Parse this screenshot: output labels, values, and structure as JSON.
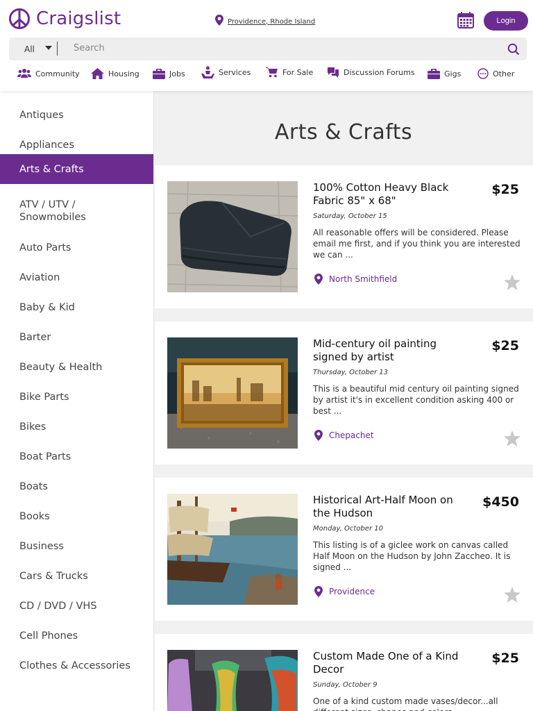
{
  "header": {
    "logo_text": "Craigslist",
    "location": "Providence, Rhode Island",
    "login_label": "Login",
    "brand_color": "#6b2c8f"
  },
  "search": {
    "category": "All",
    "placeholder": "Search"
  },
  "nav": [
    {
      "label": "Community",
      "icon": "community-icon"
    },
    {
      "label": "Housing",
      "icon": "house-icon"
    },
    {
      "label": "Jobs",
      "icon": "briefcase-icon"
    },
    {
      "label": "Services",
      "icon": "services-icon"
    },
    {
      "label": "For Sale",
      "icon": "cart-icon"
    },
    {
      "label": "Discussion Forums",
      "icon": "chat-icon"
    },
    {
      "label": "Gigs",
      "icon": "briefcase-icon"
    },
    {
      "label": "Other",
      "icon": "more-icon"
    }
  ],
  "sidebar": {
    "items": [
      {
        "label": "Antiques"
      },
      {
        "label": "Appliances"
      },
      {
        "label": "Arts & Crafts",
        "active": true
      },
      {
        "label": "ATV / UTV / Snowmobiles"
      },
      {
        "label": "Auto Parts"
      },
      {
        "label": "Aviation"
      },
      {
        "label": "Baby & Kid"
      },
      {
        "label": "Barter"
      },
      {
        "label": "Beauty & Health"
      },
      {
        "label": "Bike Parts"
      },
      {
        "label": "Bikes"
      },
      {
        "label": "Boat Parts"
      },
      {
        "label": "Boats"
      },
      {
        "label": "Books"
      },
      {
        "label": "Business"
      },
      {
        "label": "Cars & Trucks"
      },
      {
        "label": "CD / DVD / VHS"
      },
      {
        "label": "Cell Phones"
      },
      {
        "label": "Clothes & Accessories"
      }
    ]
  },
  "main": {
    "title": "Arts & Crafts",
    "listings": [
      {
        "title": "100% Cotton Heavy Black Fabric 85\" x 68\"",
        "price": "$25",
        "date": "Saturday, October 15",
        "description": "All reasonable offers will be considered. Please email me first, and if you think you are interested we can ...",
        "location": "North Smithfield"
      },
      {
        "title": "Mid-century oil painting signed by artist",
        "price": "$25",
        "date": "Thursday, October 13",
        "description": "This is a beautiful mid century oil painting signed by artist it's in excellent condition asking 400 or best ...",
        "location": "Chepachet"
      },
      {
        "title": "Historical Art-Half Moon on the Hudson",
        "price": "$450",
        "date": "Monday, October 10",
        "description": "This listing is of a giclee work on canvas called Half Moon on the Hudson by John Zaccheo. It is signed ...",
        "location": "Providence"
      },
      {
        "title": "Custom Made One of a Kind Decor",
        "price": "$25",
        "date": "Sunday, October 9",
        "description": "One of a kind custom made vases/decor...all different sizes, shapes and colors"
      }
    ]
  }
}
